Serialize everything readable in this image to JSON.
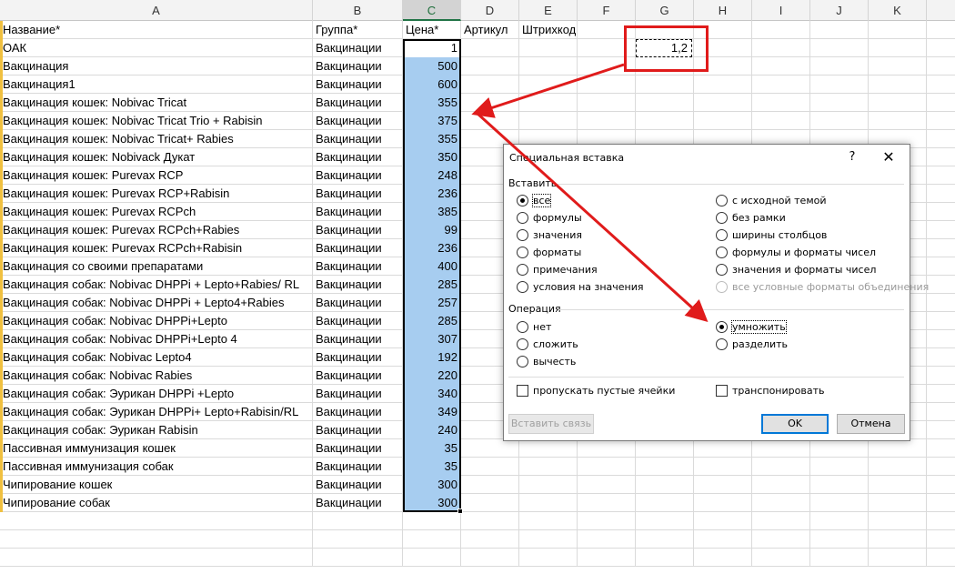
{
  "columns": [
    "A",
    "B",
    "C",
    "D",
    "E",
    "F",
    "G",
    "H",
    "I",
    "J",
    "K"
  ],
  "header_row": {
    "name": "Название*",
    "group": "Группа*",
    "price": "Цена*",
    "article": "Артикул",
    "barcode": "Штрихкод"
  },
  "rows": [
    {
      "name": "ОАК",
      "group": "Вакцинации",
      "price": "1"
    },
    {
      "name": "Вакцинация",
      "group": "Вакцинации",
      "price": "500"
    },
    {
      "name": "Вакцинация1",
      "group": "Вакцинации",
      "price": "600"
    },
    {
      "name": "Вакцинация кошек: Nobivac Tricat",
      "group": "Вакцинации",
      "price": "355"
    },
    {
      "name": "Вакцинация кошек: Nobivac Tricat Trio + Rabisin",
      "group": "Вакцинации",
      "price": "375"
    },
    {
      "name": "Вакцинация кошек: Nobivac Tricat+ Rabies",
      "group": "Вакцинации",
      "price": "355"
    },
    {
      "name": "Вакцинация кошек: Nobivack Дукат",
      "group": "Вакцинации",
      "price": "350"
    },
    {
      "name": "Вакцинация кошек: Purevax RCP",
      "group": "Вакцинации",
      "price": "248"
    },
    {
      "name": "Вакцинация кошек: Purevax RCP+Rabisin",
      "group": "Вакцинации",
      "price": "236"
    },
    {
      "name": "Вакцинация кошек: Purevax RCPch",
      "group": "Вакцинации",
      "price": "385"
    },
    {
      "name": "Вакцинация кошек: Purevax RCPch+Rabies",
      "group": "Вакцинации",
      "price": "99"
    },
    {
      "name": "Вакцинация кошек: Purevax RCPch+Rabisin",
      "group": "Вакцинации",
      "price": "236"
    },
    {
      "name": "Вакцинация со своими препаратами",
      "group": "Вакцинации",
      "price": "400"
    },
    {
      "name": "Вакцинация собак: Nobivac DHPPi + Lepto+Rabies/ RL",
      "group": "Вакцинации",
      "price": "285"
    },
    {
      "name": "Вакцинация собак: Nobivac DHPPi + Lepto4+Rabies",
      "group": "Вакцинации",
      "price": "257"
    },
    {
      "name": "Вакцинация собак: Nobivac DHPPi+Lepto",
      "group": "Вакцинации",
      "price": "285"
    },
    {
      "name": "Вакцинация собак: Nobivac DHPPi+Lepto 4",
      "group": "Вакцинации",
      "price": "307"
    },
    {
      "name": "Вакцинация собак: Nobivac Lepto4",
      "group": "Вакцинации",
      "price": "192"
    },
    {
      "name": "Вакцинация собак: Nobivac Rabies",
      "group": "Вакцинации",
      "price": "220"
    },
    {
      "name": "Вакцинация собак: Эурикан DHPPi +Lepto",
      "group": "Вакцинации",
      "price": "340"
    },
    {
      "name": "Вакцинация собак: Эурикан DHPPi+ Lepto+Rabisin/RL",
      "group": "Вакцинации",
      "price": "349"
    },
    {
      "name": "Вакцинация собак: Эурикан Rabisin",
      "group": "Вакцинации",
      "price": "240"
    },
    {
      "name": "Пассивная иммунизация кошек",
      "group": "Вакцинации",
      "price": "35"
    },
    {
      "name": "Пассивная иммунизация собак",
      "group": "Вакцинации",
      "price": "35"
    },
    {
      "name": "Чипирование кошек",
      "group": "Вакцинации",
      "price": "300"
    },
    {
      "name": "Чипирование собак",
      "group": "Вакцинации",
      "price": "300"
    }
  ],
  "copied_cell_value": "1,2",
  "dialog": {
    "title": "Специальная вставка",
    "help": "?",
    "close": "✕",
    "paste_group": "Вставить",
    "paste_left": [
      "все",
      "формулы",
      "значения",
      "форматы",
      "примечания",
      "условия на значения"
    ],
    "paste_right": [
      "с исходной темой",
      "без рамки",
      "ширины столбцов",
      "формулы и форматы чисел",
      "значения и форматы чисел",
      "все условные форматы объединения"
    ],
    "paste_selected": "все",
    "operation_group": "Операция",
    "op_left": [
      "нет",
      "сложить",
      "вычесть"
    ],
    "op_right": [
      "умножить",
      "разделить"
    ],
    "op_selected": "умножить",
    "skip_blanks": "пропускать пустые ячейки",
    "transpose": "транспонировать",
    "paste_link": "Вставить связь",
    "ok": "OK",
    "cancel": "Отмена"
  },
  "colors": {
    "selection_fill": "#a7cdf0",
    "annotation_red": "#e01b1b",
    "selected_header": "#217346"
  }
}
